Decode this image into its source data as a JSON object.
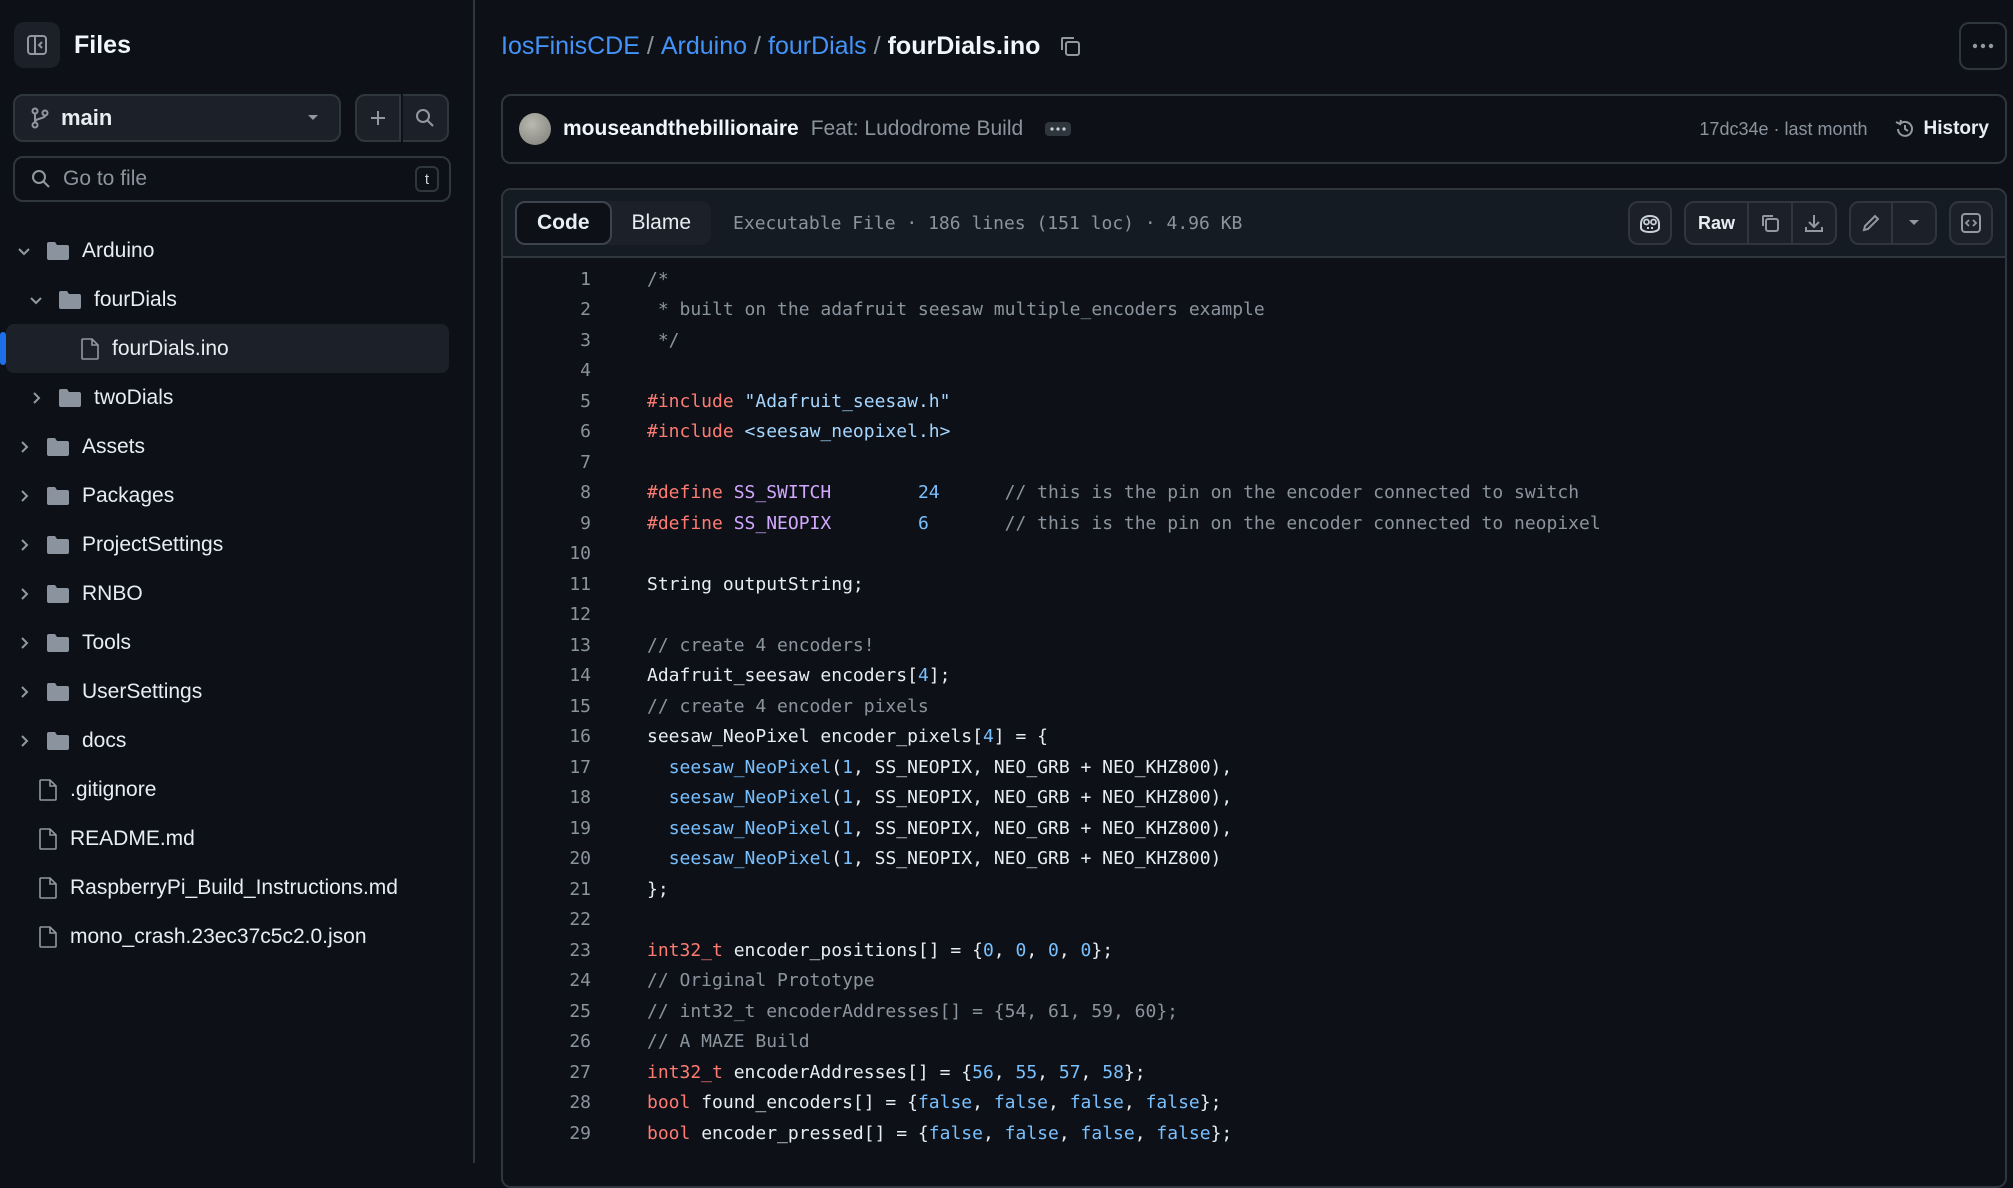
{
  "sidebar": {
    "title": "Files",
    "branch": "main",
    "goto_placeholder": "Go to file",
    "goto_shortcut": "t",
    "tree": [
      {
        "label": "Arduino",
        "type": "folder",
        "depth": 0,
        "expanded": true
      },
      {
        "label": "fourDials",
        "type": "folder",
        "depth": 1,
        "expanded": true
      },
      {
        "label": "fourDials.ino",
        "type": "file",
        "depth": 2,
        "selected": true
      },
      {
        "label": "twoDials",
        "type": "folder",
        "depth": 1,
        "expanded": false
      },
      {
        "label": "Assets",
        "type": "folder",
        "depth": 0,
        "expanded": false
      },
      {
        "label": "Packages",
        "type": "folder",
        "depth": 0,
        "expanded": false
      },
      {
        "label": "ProjectSettings",
        "type": "folder",
        "depth": 0,
        "expanded": false
      },
      {
        "label": "RNBO",
        "type": "folder",
        "depth": 0,
        "expanded": false
      },
      {
        "label": "Tools",
        "type": "folder",
        "depth": 0,
        "expanded": false
      },
      {
        "label": "UserSettings",
        "type": "folder",
        "depth": 0,
        "expanded": false
      },
      {
        "label": "docs",
        "type": "folder",
        "depth": 0,
        "expanded": false
      },
      {
        "label": ".gitignore",
        "type": "file",
        "depth": 0
      },
      {
        "label": "README.md",
        "type": "file",
        "depth": 0
      },
      {
        "label": "RaspberryPi_Build_Instructions.md",
        "type": "file",
        "depth": 0
      },
      {
        "label": "mono_crash.23ec37c5c2.0.json",
        "type": "file",
        "depth": 0
      }
    ]
  },
  "breadcrumb": {
    "parts": [
      "IosFinisCDE",
      "Arduino",
      "fourDials"
    ],
    "separator": "/",
    "current": "fourDials.ino"
  },
  "commit": {
    "author": "mouseandthebillionaire",
    "message": "Feat: Ludodrome Build",
    "meta": "17dc34e · last month",
    "history_label": "History"
  },
  "viewer": {
    "tab_code": "Code",
    "tab_blame": "Blame",
    "file_info": "Executable File · 186 lines (151 loc) · 4.96 KB",
    "raw_label": "Raw"
  },
  "colors": {
    "accent": "#4493f8",
    "selection_bar": "#1f6feb",
    "keyword": "#ff7b72",
    "string": "#a5d6ff",
    "number": "#79c0ff",
    "define": "#d2a8ff",
    "comment": "#8b949e"
  },
  "code_lines": [
    [
      [
        "c",
        "/*"
      ]
    ],
    [
      [
        "c",
        " * built on the adafruit seesaw multiple_encoders example"
      ]
    ],
    [
      [
        "c",
        " */"
      ]
    ],
    [],
    [
      [
        "k",
        "#include"
      ],
      [
        "t",
        " "
      ],
      [
        "s",
        "\"Adafruit_seesaw.h\""
      ]
    ],
    [
      [
        "k",
        "#include"
      ],
      [
        "t",
        " "
      ],
      [
        "s",
        "<seesaw_neopixel.h>"
      ]
    ],
    [],
    [
      [
        "k",
        "#define"
      ],
      [
        "t",
        " "
      ],
      [
        "d",
        "SS_SWITCH"
      ],
      [
        "t",
        "        "
      ],
      [
        "n",
        "24"
      ],
      [
        "t",
        "      "
      ],
      [
        "c",
        "// this is the pin on the encoder connected to switch"
      ]
    ],
    [
      [
        "k",
        "#define"
      ],
      [
        "t",
        " "
      ],
      [
        "d",
        "SS_NEOPIX"
      ],
      [
        "t",
        "        "
      ],
      [
        "n",
        "6"
      ],
      [
        "t",
        "       "
      ],
      [
        "c",
        "// this is the pin on the encoder connected to neopixel"
      ]
    ],
    [],
    [
      [
        "t",
        "String outputString;"
      ]
    ],
    [],
    [
      [
        "c",
        "// create 4 encoders!"
      ]
    ],
    [
      [
        "t",
        "Adafruit_seesaw encoders["
      ],
      [
        "n",
        "4"
      ],
      [
        "t",
        "];"
      ]
    ],
    [
      [
        "c",
        "// create 4 encoder pixels"
      ]
    ],
    [
      [
        "t",
        "seesaw_NeoPixel encoder_pixels["
      ],
      [
        "n",
        "4"
      ],
      [
        "t",
        "] = {"
      ]
    ],
    [
      [
        "t",
        "  "
      ],
      [
        "f",
        "seesaw_NeoPixel"
      ],
      [
        "t",
        "("
      ],
      [
        "n",
        "1"
      ],
      [
        "t",
        ", SS_NEOPIX, NEO_GRB + NEO_KHZ800),"
      ]
    ],
    [
      [
        "t",
        "  "
      ],
      [
        "f",
        "seesaw_NeoPixel"
      ],
      [
        "t",
        "("
      ],
      [
        "n",
        "1"
      ],
      [
        "t",
        ", SS_NEOPIX, NEO_GRB + NEO_KHZ800),"
      ]
    ],
    [
      [
        "t",
        "  "
      ],
      [
        "f",
        "seesaw_NeoPixel"
      ],
      [
        "t",
        "("
      ],
      [
        "n",
        "1"
      ],
      [
        "t",
        ", SS_NEOPIX, NEO_GRB + NEO_KHZ800),"
      ]
    ],
    [
      [
        "t",
        "  "
      ],
      [
        "f",
        "seesaw_NeoPixel"
      ],
      [
        "t",
        "("
      ],
      [
        "n",
        "1"
      ],
      [
        "t",
        ", SS_NEOPIX, NEO_GRB + NEO_KHZ800)"
      ]
    ],
    [
      [
        "t",
        "};"
      ]
    ],
    [],
    [
      [
        "k",
        "int32_t"
      ],
      [
        "t",
        " encoder_positions[] = {"
      ],
      [
        "n",
        "0"
      ],
      [
        "t",
        ", "
      ],
      [
        "n",
        "0"
      ],
      [
        "t",
        ", "
      ],
      [
        "n",
        "0"
      ],
      [
        "t",
        ", "
      ],
      [
        "n",
        "0"
      ],
      [
        "t",
        "};"
      ]
    ],
    [
      [
        "c",
        "// Original Prototype"
      ]
    ],
    [
      [
        "c",
        "// int32_t encoderAddresses[] = {54, 61, 59, 60};"
      ]
    ],
    [
      [
        "c",
        "// A MAZE Build"
      ]
    ],
    [
      [
        "k",
        "int32_t"
      ],
      [
        "t",
        " encoderAddresses[] = {"
      ],
      [
        "n",
        "56"
      ],
      [
        "t",
        ", "
      ],
      [
        "n",
        "55"
      ],
      [
        "t",
        ", "
      ],
      [
        "n",
        "57"
      ],
      [
        "t",
        ", "
      ],
      [
        "n",
        "58"
      ],
      [
        "t",
        "};"
      ]
    ],
    [
      [
        "k",
        "bool"
      ],
      [
        "t",
        " found_encoders[] = {"
      ],
      [
        "n",
        "false"
      ],
      [
        "t",
        ", "
      ],
      [
        "n",
        "false"
      ],
      [
        "t",
        ", "
      ],
      [
        "n",
        "false"
      ],
      [
        "t",
        ", "
      ],
      [
        "n",
        "false"
      ],
      [
        "t",
        "};"
      ]
    ],
    [
      [
        "k",
        "bool"
      ],
      [
        "t",
        " encoder_pressed[] = {"
      ],
      [
        "n",
        "false"
      ],
      [
        "t",
        ", "
      ],
      [
        "n",
        "false"
      ],
      [
        "t",
        ", "
      ],
      [
        "n",
        "false"
      ],
      [
        "t",
        ", "
      ],
      [
        "n",
        "false"
      ],
      [
        "t",
        "};"
      ]
    ]
  ]
}
